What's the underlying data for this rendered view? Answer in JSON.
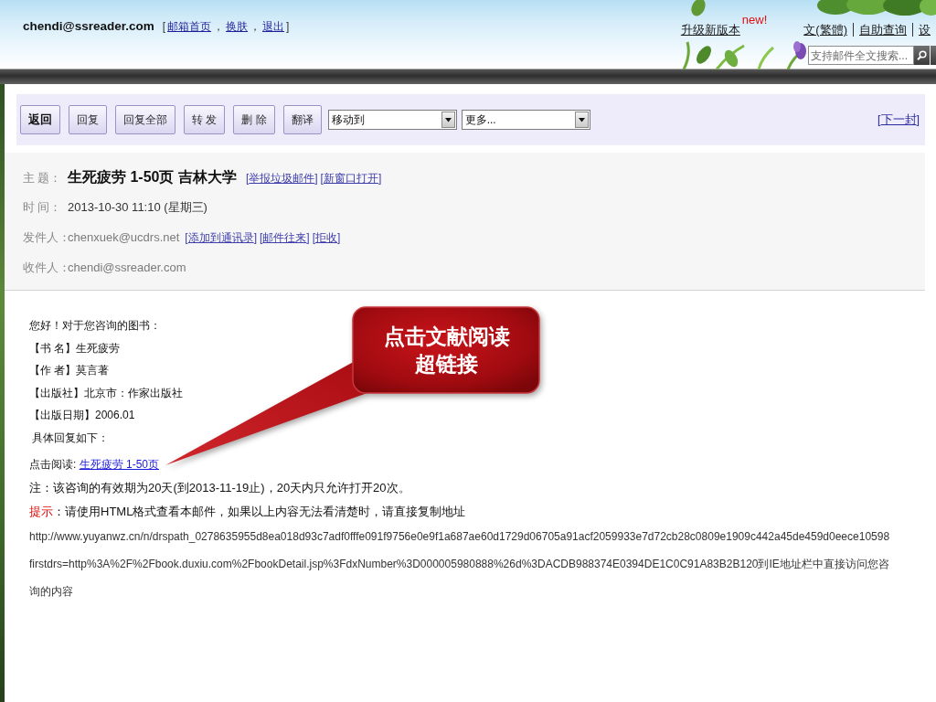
{
  "header": {
    "account": "chendi@ssreader.com",
    "account_links": {
      "brackets": [
        "[",
        "]"
      ],
      "separator": "，",
      "items": [
        "邮箱首页",
        "换肤",
        "退出"
      ]
    },
    "top_links": [
      {
        "label": "升级新版本",
        "badge": "new!"
      },
      {
        "label": "文(繁體)"
      },
      {
        "label": "自助查询"
      },
      {
        "label": "设"
      }
    ],
    "search": {
      "placeholder": "支持邮件全文搜索..."
    }
  },
  "toolbar": {
    "buttons": [
      {
        "label": "返回",
        "emphasized": true
      },
      {
        "label": "回复",
        "emphasized": false
      },
      {
        "label": "回复全部",
        "emphasized": false
      },
      {
        "label": "转 发",
        "emphasized": false
      },
      {
        "label": "删 除",
        "emphasized": false
      },
      {
        "label": "翻译",
        "emphasized": false
      }
    ],
    "dropdowns": [
      {
        "value": "移动到"
      },
      {
        "value": "更多..."
      }
    ],
    "next_link": {
      "brackets": [
        "[",
        "]"
      ],
      "label": "下一封"
    }
  },
  "message": {
    "link_brackets": [
      "[",
      "]"
    ],
    "fields": [
      {
        "kind": "subject",
        "label": "主 题：",
        "value": "生死疲劳 1-50页 吉林大学",
        "links": [
          "举报垃圾邮件",
          "新窗口打开"
        ]
      },
      {
        "kind": "date",
        "label": "时 间：",
        "value": "2013-10-30 11:10 (星期三)"
      },
      {
        "kind": "sender",
        "label": "发件人：",
        "value": "chenxuek@ucdrs.net",
        "links": [
          "添加到通讯录",
          "邮件往来",
          "拒收"
        ]
      },
      {
        "kind": "recipient",
        "label": "收件人：",
        "value": "chendi@ssreader.com"
      }
    ]
  },
  "body": {
    "lines": [
      "您好！对于您咨询的图书：",
      "【书 名】生死疲劳",
      "【作 者】莫言著",
      "【出版社】北京市：作家出版社",
      "【出版日期】2006.01",
      " 具体回复如下："
    ],
    "read_line": {
      "label": "点击阅读: ",
      "link": "生死疲劳 1-50页"
    },
    "note": "注：该咨询的有效期为20天(到2013-11-19止)，20天内只允许打开20次。",
    "tip": {
      "label": "提示",
      "text": "：请使用HTML格式查看本邮件，如果以上内容无法看清楚时，请直接复制地址"
    },
    "url_lines": [
      "http://www.yuyanwz.cn/n/drspath_0278635955d8ea018d93c7adf0fffe091f9756e0e9f1a687ae60d1729d06705a91acf2059933e7d72cb28c0809e1909c442a45de459d0eece10598",
      "firstdrs=http%3A%2F%2Fbook.duxiu.com%2FbookDetail.jsp%3FdxNumber%3D000005980888%26d%3DACDB988374E0394DE1C0C91A83B2B120到IE地址栏中直接访问您咨询的内容"
    ]
  },
  "callout": {
    "text": "点击文献阅读超链接"
  }
}
